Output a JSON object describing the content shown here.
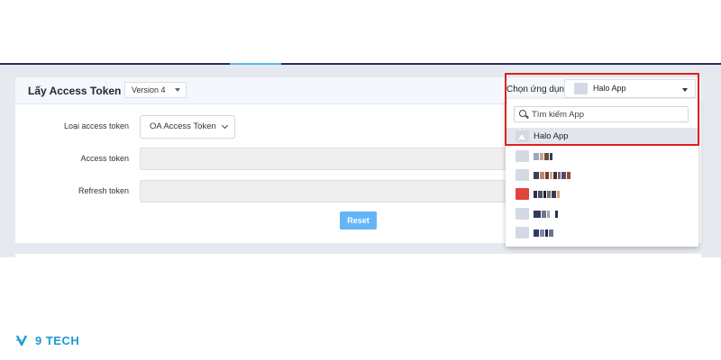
{
  "card": {
    "title": "Lấy Access Token",
    "version": "Version 4"
  },
  "form": {
    "type_label": "Loại access token",
    "type_value": "OA Access Token",
    "access_label": "Access token",
    "refresh_label": "Refresh token",
    "reset_label": "Reset"
  },
  "app_picker": {
    "label": "Chọn ứng dụng",
    "selected": "Halo App",
    "search_placeholder": "Tìm kiếm App",
    "items": [
      {
        "label": "Halo App",
        "selected": true,
        "thumb_color": "#d4dae4"
      },
      {
        "label": "",
        "blurred": true,
        "thumb_color": "#d4dae4"
      },
      {
        "label": "",
        "blurred": true,
        "thumb_color": "#d4dae4"
      },
      {
        "label": "",
        "blurred": true,
        "thumb_color": "#e0443c"
      },
      {
        "label": "",
        "blurred": true,
        "thumb_color": "#d4dae4"
      },
      {
        "label": "",
        "blurred": true,
        "thumb_color": "#d4dae4"
      }
    ]
  },
  "brand": {
    "logo_text": "9 TECH",
    "accent": "#1b9ad6",
    "highlight": "#e02020"
  }
}
